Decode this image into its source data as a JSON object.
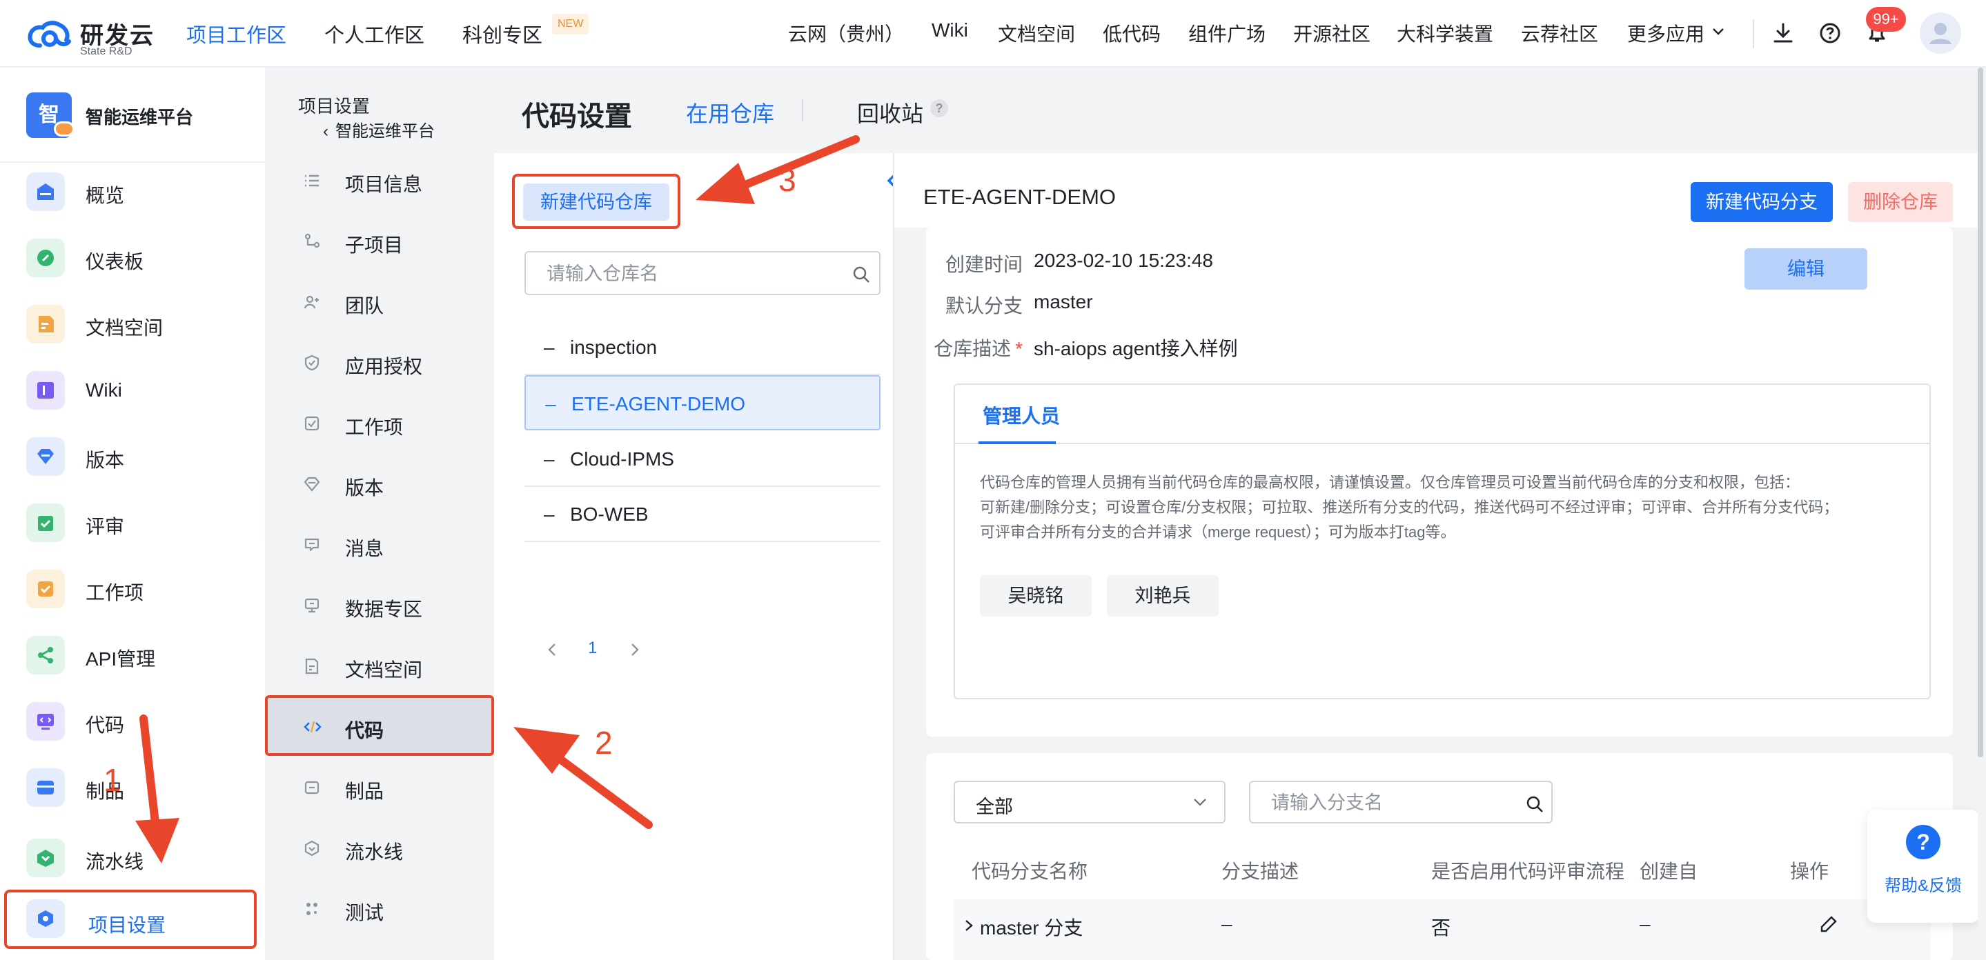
{
  "brand": {
    "title": "研发云",
    "subtitle": "State R&D",
    "accent": "#1a6ff2",
    "annotation_color": "#e9452b"
  },
  "topnav": {
    "left_items": [
      "项目工作区",
      "个人工作区",
      "科创专区"
    ],
    "new_badge": "NEW",
    "right_items": [
      "云网（贵州）",
      "Wiki",
      "文档空间",
      "低代码",
      "组件广场",
      "开源社区",
      "大科学装置",
      "云荐社区",
      "更多应用"
    ],
    "notification_count": "99+",
    "icons": [
      "download-icon",
      "help-circle-icon",
      "bell-icon",
      "user-avatar-icon"
    ]
  },
  "sidebar1": {
    "project_logo_char": "智",
    "project_name": "智能运维平台",
    "items": [
      {
        "label": "概览",
        "icon": "overview-icon",
        "color": "#3a78f2"
      },
      {
        "label": "仪表板",
        "icon": "dashboard-icon",
        "color": "#34b36f"
      },
      {
        "label": "文档空间",
        "icon": "document-icon",
        "color": "#f0a541"
      },
      {
        "label": "Wiki",
        "icon": "wiki-icon",
        "color": "#7a5af5"
      },
      {
        "label": "版本",
        "icon": "version-icon",
        "color": "#3a78f2"
      },
      {
        "label": "评审",
        "icon": "review-icon",
        "color": "#34b36f"
      },
      {
        "label": "工作项",
        "icon": "workitem-icon",
        "color": "#f0a541"
      },
      {
        "label": "API管理",
        "icon": "api-icon",
        "color": "#34b36f"
      },
      {
        "label": "代码",
        "icon": "code-icon",
        "color": "#7a5af5"
      },
      {
        "label": "制品",
        "icon": "artifact-icon",
        "color": "#3a78f2"
      },
      {
        "label": "流水线",
        "icon": "pipeline-icon",
        "color": "#34b36f"
      },
      {
        "label": "项目设置",
        "icon": "settings-icon",
        "color": "#3a78f2"
      }
    ]
  },
  "sidebar2": {
    "heading": "项目设置",
    "back_label": "智能运维平台",
    "items": [
      {
        "label": "项目信息",
        "icon": "list-icon"
      },
      {
        "label": "子项目",
        "icon": "subproject-icon"
      },
      {
        "label": "团队",
        "icon": "team-icon"
      },
      {
        "label": "应用授权",
        "icon": "shield-icon"
      },
      {
        "label": "工作项",
        "icon": "checkbox-icon"
      },
      {
        "label": "版本",
        "icon": "version-outline-icon"
      },
      {
        "label": "消息",
        "icon": "message-icon"
      },
      {
        "label": "数据专区",
        "icon": "monitor-icon"
      },
      {
        "label": "文档空间",
        "icon": "doc-outline-icon"
      },
      {
        "label": "代码",
        "icon": "code-outline-icon"
      },
      {
        "label": "制品",
        "icon": "artifact-outline-icon"
      },
      {
        "label": "流水线",
        "icon": "pipeline-outline-icon"
      },
      {
        "label": "测试",
        "icon": "test-icon"
      }
    ]
  },
  "page": {
    "title": "代码设置",
    "tabs": [
      "在用仓库",
      "回收站"
    ],
    "help_mark": "?"
  },
  "repo_panel": {
    "new_repo_button": "新建代码仓库",
    "search_placeholder": "请输入仓库名",
    "repos": [
      "inspection",
      "ETE-AGENT-DEMO",
      "Cloud-IPMS",
      "BO-WEB"
    ],
    "selected_index": 1,
    "dash": "–",
    "page_number": "1"
  },
  "detail": {
    "repo_name": "ETE-AGENT-DEMO",
    "new_branch_button": "新建代码分支",
    "delete_repo_button": "删除仓库",
    "edit_button": "编辑",
    "created_label": "创建时间",
    "created_value": "2023-02-10 15:23:48",
    "default_branch_label": "默认分支",
    "default_branch_value": "master",
    "desc_label": "仓库描述",
    "required_mark": "*",
    "desc_value": "sh-aiops agent接入样例",
    "admin_tab": "管理人员",
    "admin_desc_1": "代码仓库的管理人员拥有当前代码仓库的最高权限，请谨慎设置。仅仓库管理员可设置当前代码仓库的分支和权限，包括：",
    "admin_desc_2": "可新建/删除分支；可设置仓库/分支权限；可拉取、推送所有分支的代码，推送代码可不经过评审；可评审、合并所有分支代码；",
    "admin_desc_3": "可评审合并所有分支的合并请求（merge request）；可为版本打tag等。",
    "members": [
      "吴晓铭",
      "刘艳兵"
    ]
  },
  "branches": {
    "filter_value": "全部",
    "search_placeholder": "请输入分支名",
    "columns": [
      "代码分支名称",
      "分支描述",
      "是否启用代码评审流程",
      "创建自",
      "操作"
    ],
    "rows": [
      {
        "name": "master 分支",
        "desc": "–",
        "review": "否",
        "from": "–"
      }
    ]
  },
  "help_float": {
    "icon": "?",
    "label": "帮助&反馈"
  },
  "annotations": [
    "1",
    "2",
    "3"
  ]
}
